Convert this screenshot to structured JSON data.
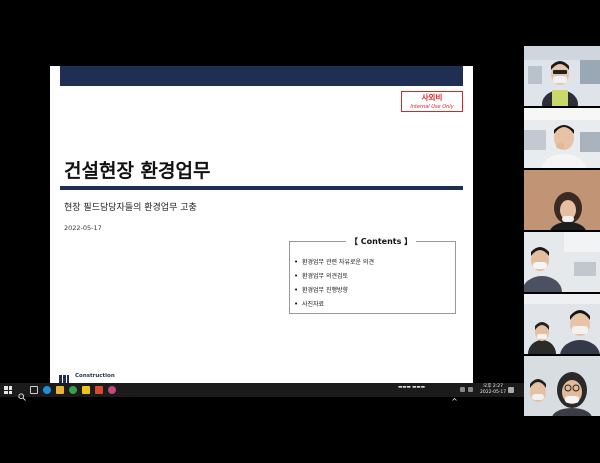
{
  "slide": {
    "classification_main": "사외비",
    "classification_sub": "Internal Use Only",
    "title": "건설현장 환경업무",
    "subtitle": "현장 필드담당자들의 환경업무 고충",
    "date": "2022-05-17",
    "contents": {
      "heading": "【 Contents 】",
      "items": [
        "환경업무 관련 자유로운 의견",
        "환경업무 의견검토",
        "환경업무 진행방향",
        "사진자료"
      ]
    },
    "footer_logo_text": "Construction"
  },
  "taskbar": {
    "tray_text": "▬▬▬ ▬▬▬",
    "clock_time": "오후 2:27",
    "clock_date": "2022-05-17",
    "icons": [
      "windows-start-icon",
      "search-icon",
      "task-view-icon",
      "edge-icon",
      "file-explorer-icon",
      "chrome-icon",
      "app-icon",
      "office-icon",
      "app-icon"
    ]
  },
  "participants": {
    "count": 6,
    "colors": {
      "office": "#dfe4ea",
      "skin": "#e8c4a8",
      "hair": "#1a1a1a",
      "mask": "#f2f2f2"
    }
  },
  "colors": {
    "navy": "#1f2f54",
    "classification_red": "#d9262c",
    "background": "#000000"
  }
}
